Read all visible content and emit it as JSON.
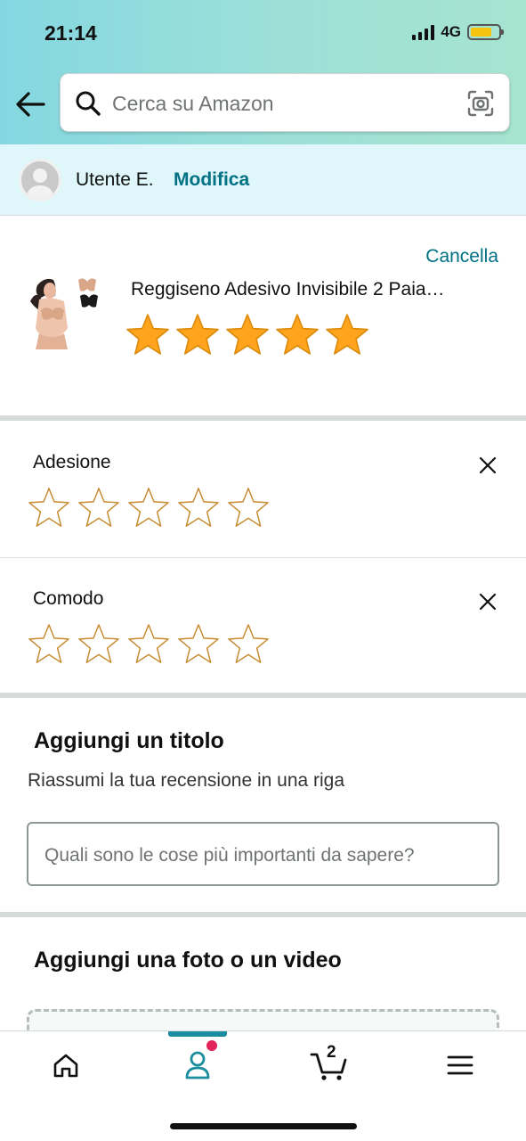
{
  "status_bar": {
    "time": "21:14",
    "network": "4G"
  },
  "search": {
    "placeholder": "Cerca su Amazon"
  },
  "user": {
    "name": "Utente E.",
    "edit_label": "Modifica"
  },
  "product": {
    "cancel_label": "Cancella",
    "title": "Reggiseno Adesivo Invisibile 2 Paia…",
    "rating": 5,
    "max_rating": 5
  },
  "attributes": [
    {
      "label": "Adesione",
      "rating": 0,
      "max_rating": 5
    },
    {
      "label": "Comodo",
      "rating": 0,
      "max_rating": 5
    }
  ],
  "title_section": {
    "heading": "Aggiungi un titolo",
    "subtitle": "Riassumi la tua recensione in una riga",
    "input_placeholder": "Quali sono le cose più importanti da sapere?"
  },
  "media_section": {
    "heading": "Aggiungi una foto o un video"
  },
  "tabbar": {
    "cart_count": "2",
    "items": [
      {
        "name": "home",
        "icon": "home-icon"
      },
      {
        "name": "account",
        "icon": "account-icon"
      },
      {
        "name": "cart",
        "icon": "cart-icon"
      },
      {
        "name": "menu",
        "icon": "hamburger-icon"
      }
    ]
  },
  "colors": {
    "link": "#007185",
    "star_fill": "#ffa41c",
    "star_outline": "#c8892e",
    "active_tab": "#1a8d9e",
    "badge": "#e3245b"
  }
}
